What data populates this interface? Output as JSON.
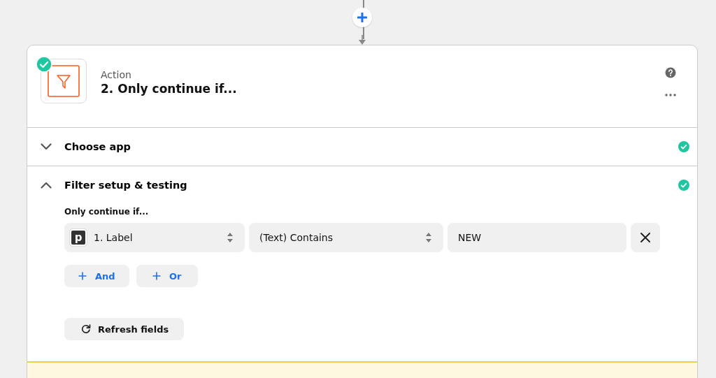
{
  "step": {
    "type_label": "Action",
    "title": "2. Only continue if...",
    "complete": true
  },
  "sections": [
    {
      "title": "Choose app",
      "expanded": false,
      "complete": true
    },
    {
      "title": "Filter setup & testing",
      "expanded": true,
      "complete": true
    }
  ],
  "filter": {
    "label": "Only continue if...",
    "conditions": [
      {
        "field": {
          "app_letter": "p",
          "value": "1. Label"
        },
        "operator": "(Text) Contains",
        "value": "NEW"
      }
    ],
    "add_buttons": [
      "And",
      "Or"
    ],
    "refresh_button": "Refresh fields"
  },
  "notice": {
    "kind": "warning"
  }
}
